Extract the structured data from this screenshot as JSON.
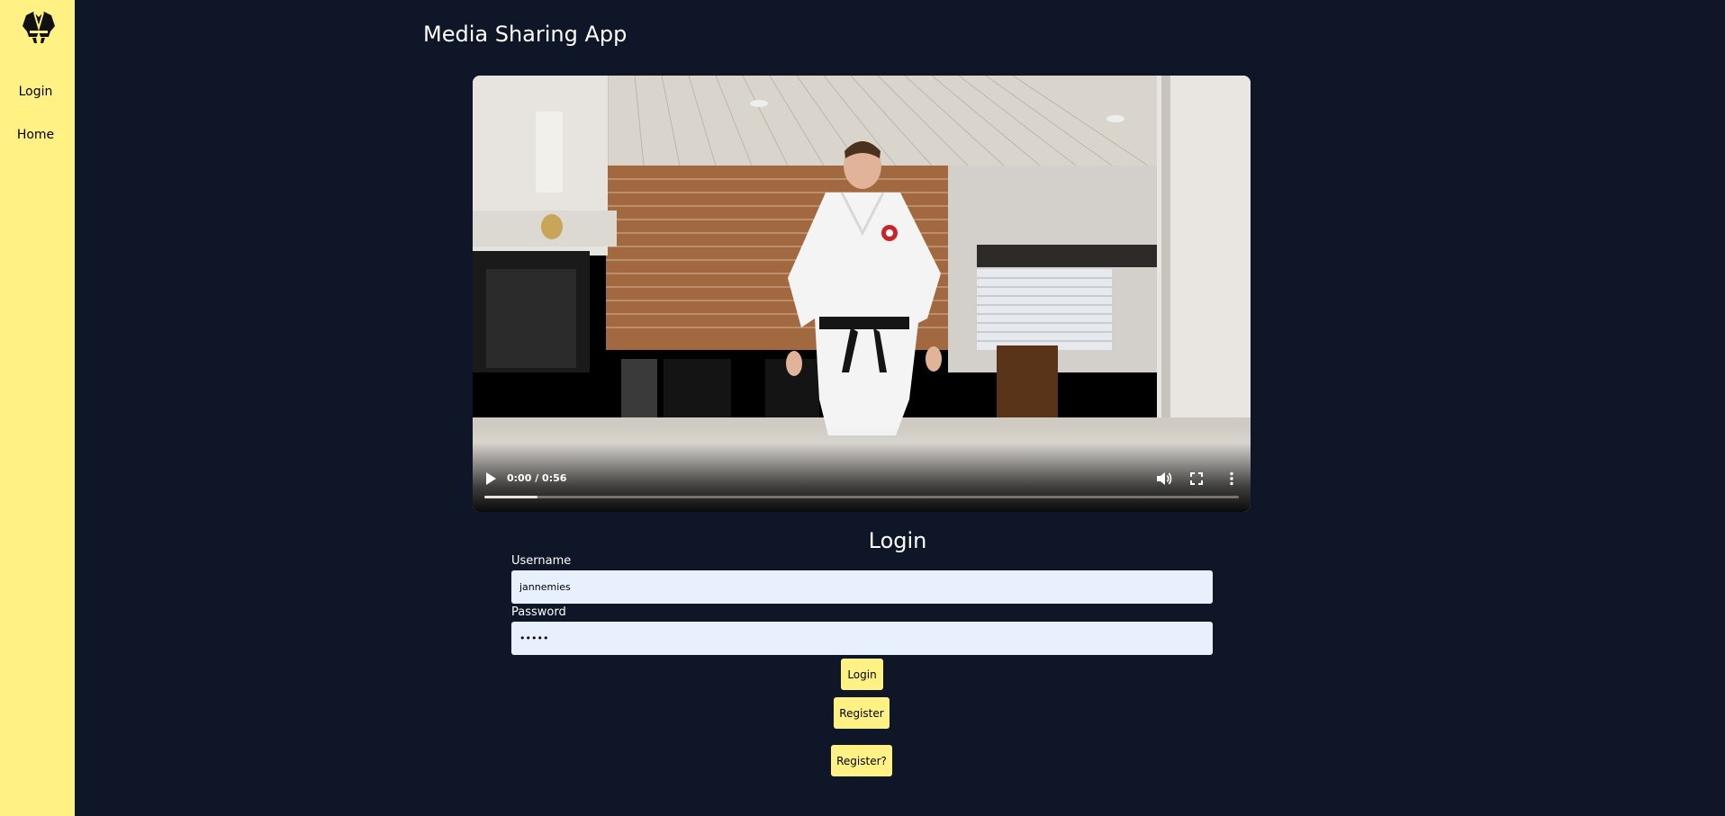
{
  "app": {
    "title": "Media Sharing App"
  },
  "sidebar": {
    "logo_icon": "karate-gi-icon",
    "items": [
      {
        "label": "Login"
      },
      {
        "label": "Home"
      }
    ]
  },
  "video": {
    "time_display": "0:00 / 0:56",
    "progress_buffered_fraction": 0.07,
    "controls": [
      "play-icon",
      "volume-icon",
      "fullscreen-icon",
      "more-options-icon"
    ]
  },
  "login_form": {
    "heading": "Login",
    "username_label": "Username",
    "username_value": "jannemies",
    "password_label": "Password",
    "password_value": "•••••",
    "login_button": "Login",
    "register_button": "Register",
    "register_toggle_button": "Register?"
  },
  "colors": {
    "background": "#0e1628",
    "accent": "#fff183",
    "input_bg": "#e8f0fe"
  }
}
